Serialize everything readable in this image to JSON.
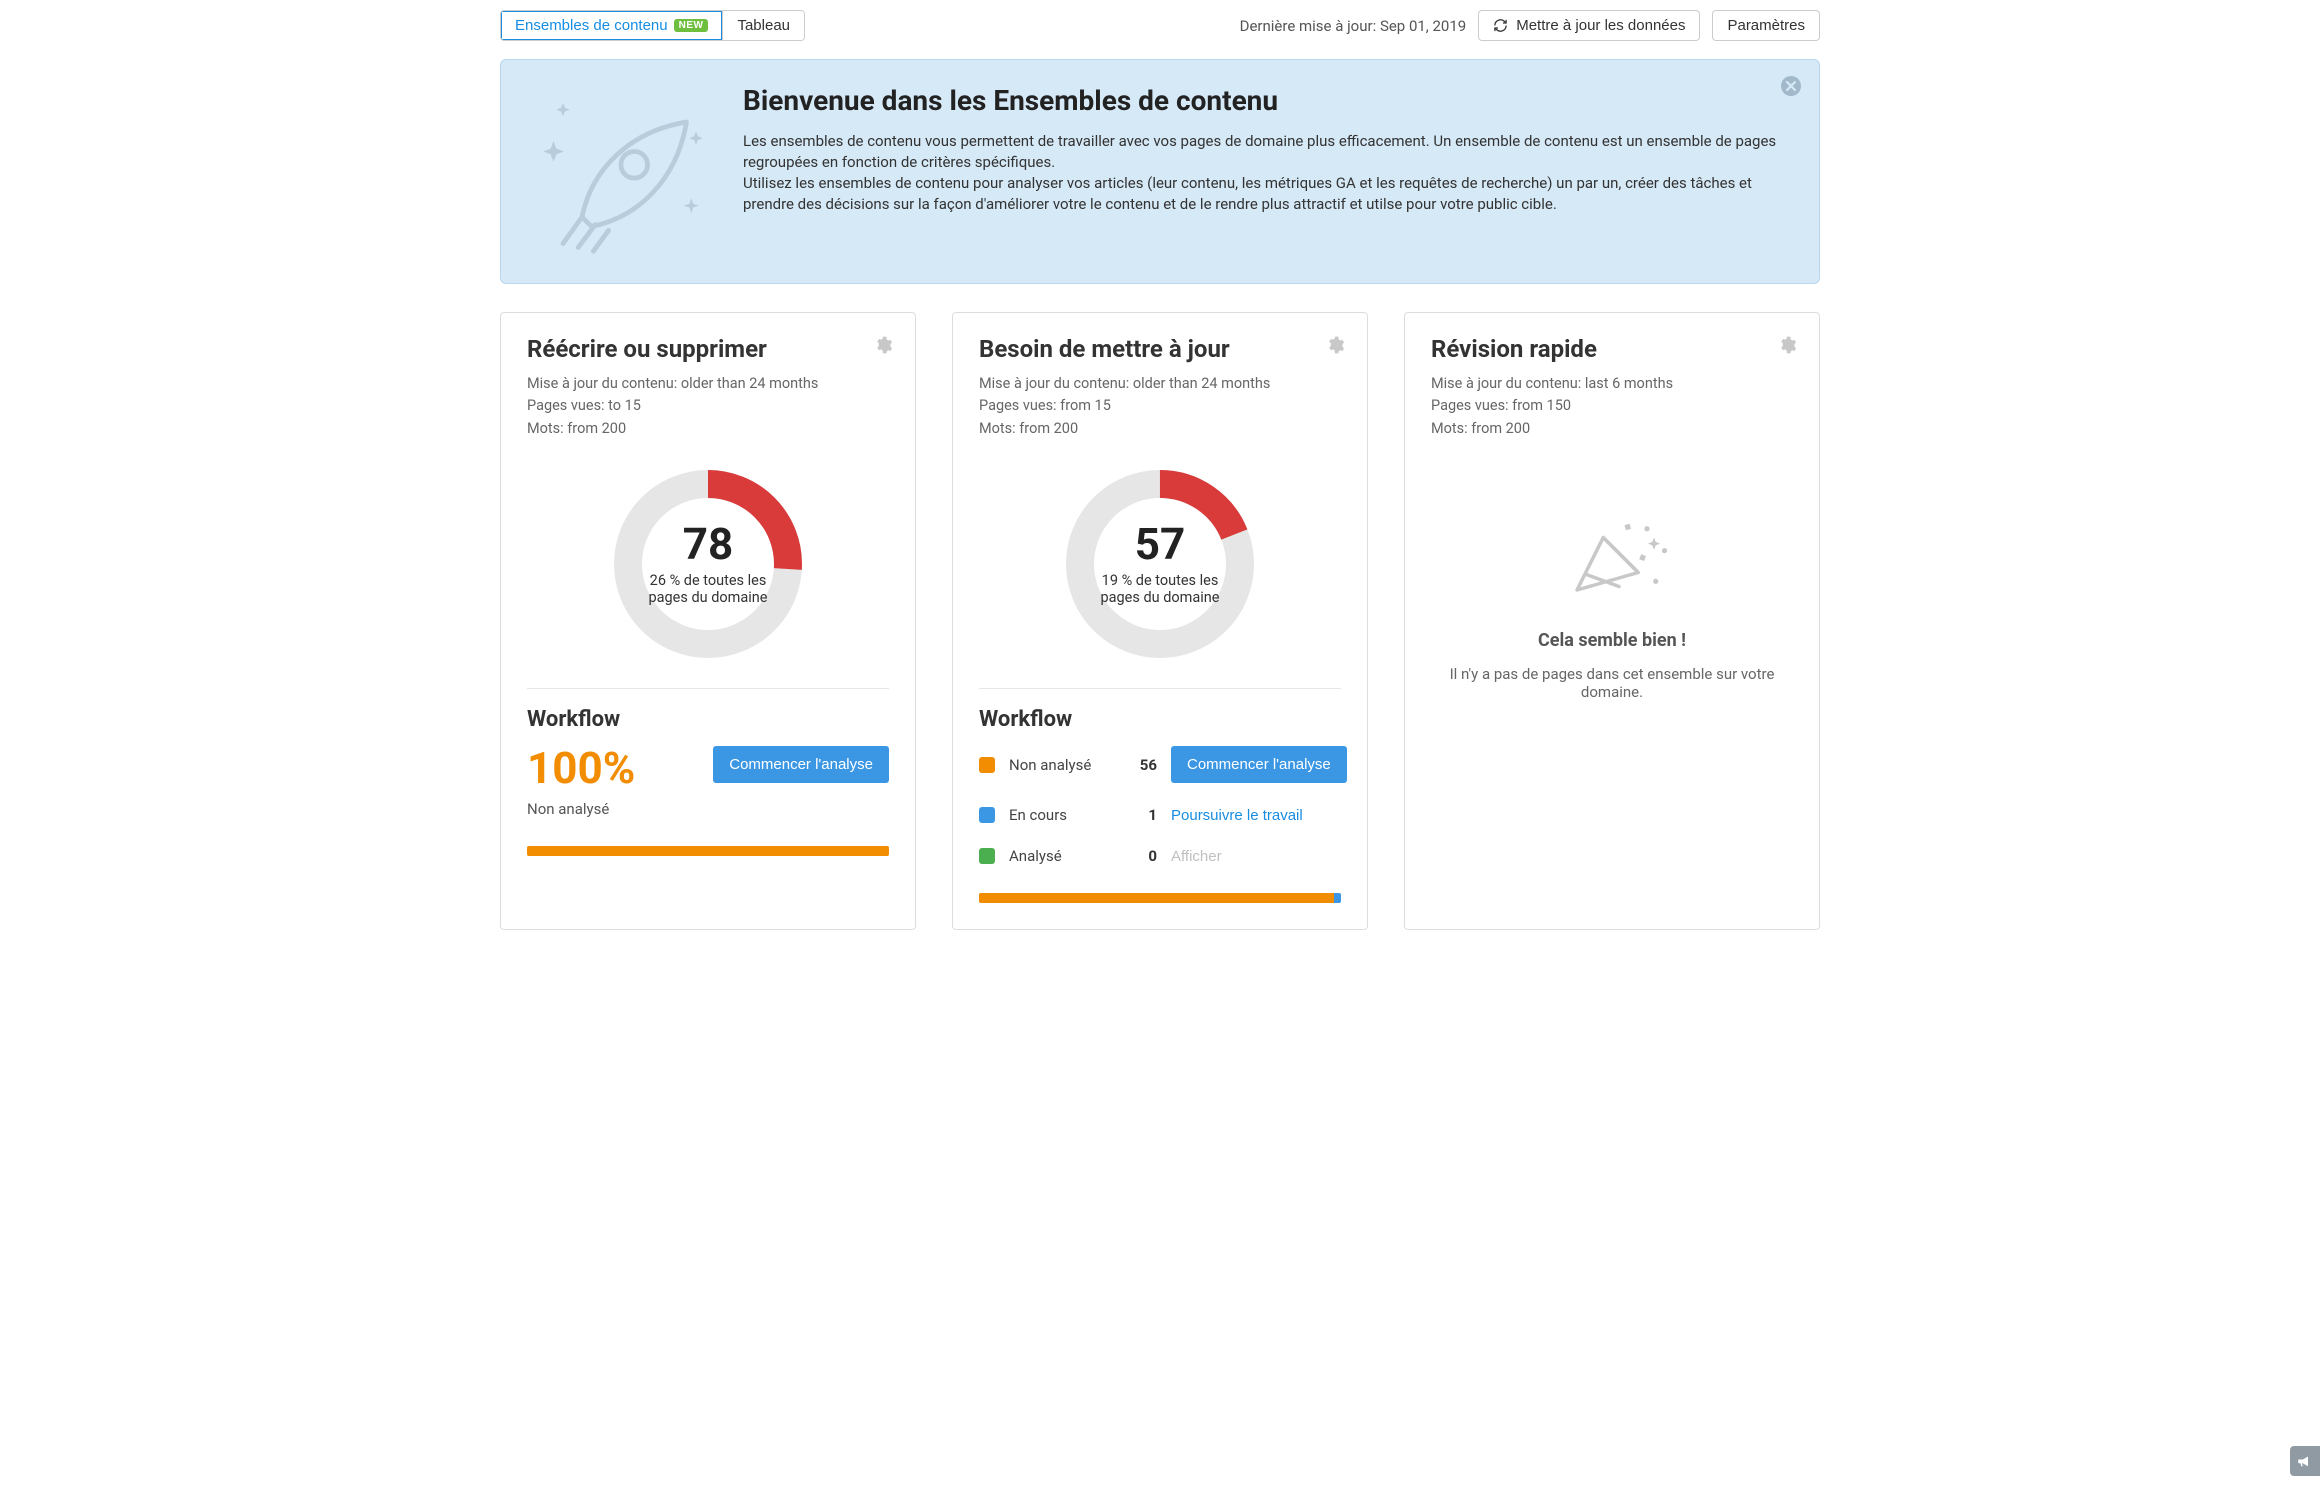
{
  "topbar": {
    "tab_content_sets": "Ensembles de contenu",
    "tab_content_sets_badge": "NEW",
    "tab_table": "Tableau",
    "last_update_label": "Dernière mise à jour: Sep 01, 2019",
    "refresh_btn": "Mettre à jour les données",
    "settings_btn": "Paramètres"
  },
  "banner": {
    "title": "Bienvenue dans les Ensembles de contenu",
    "p1": "Les ensembles de contenu vous permettent de travailler avec vos pages de domaine plus efficacement. Un ensemble de contenu est un ensemble de pages regroupées en fonction de critères spécifiques.",
    "p2": "Utilisez les ensembles de contenu pour analyser vos articles (leur contenu, les métriques GA et les requêtes de recherche) un par un, créer des tâches et prendre des décisions sur la façon d'améliorer votre le contenu et de le rendre plus attractif et utilse pour votre public cible."
  },
  "cards": {
    "c1": {
      "title": "Réécrire ou supprimer",
      "crit1": "Mise à jour du contenu: older than 24 months",
      "crit2": "Pages vues: to 15",
      "crit3": "Mots: from 200",
      "big": "78",
      "sub": "26 % de toutes les pages du domaine",
      "wf_title": "Workflow",
      "pct": "100%",
      "pct_label": "Non analysé",
      "cta": "Commencer l'analyse"
    },
    "c2": {
      "title": "Besoin de mettre à jour",
      "crit1": "Mise à jour du contenu: older than 24 months",
      "crit2": "Pages vues: from 15",
      "crit3": "Mots: from 200",
      "big": "57",
      "sub": "19 % de toutes les pages du domaine",
      "wf_title": "Workflow",
      "rows": [
        {
          "name": "Non analysé",
          "val": "56",
          "action": "Commencer l'analyse",
          "color": "orange",
          "kind": "primary"
        },
        {
          "name": "En cours",
          "val": "1",
          "action": "Poursuivre le travail",
          "color": "blue",
          "kind": "link"
        },
        {
          "name": "Analysé",
          "val": "0",
          "action": "Afficher",
          "color": "green",
          "kind": "muted"
        }
      ]
    },
    "c3": {
      "title": "Révision rapide",
      "crit1": "Mise à jour du contenu: last 6 months",
      "crit2": "Pages vues: from 150",
      "crit3": "Mots: from 200",
      "empty_title": "Cela semble bien !",
      "empty_text": "Il n'y a pas de pages dans cet ensemble sur votre domaine."
    }
  },
  "chart_data": [
    {
      "type": "pie",
      "title": "Réécrire ou supprimer",
      "series": [
        {
          "name": "part",
          "values": [
            26,
            74
          ]
        }
      ],
      "center_value": 78,
      "percent": 26,
      "colors": [
        "#d93a3a",
        "#e6e6e6"
      ]
    },
    {
      "type": "pie",
      "title": "Besoin de mettre à jour",
      "series": [
        {
          "name": "part",
          "values": [
            19,
            81
          ]
        }
      ],
      "center_value": 57,
      "percent": 19,
      "colors": [
        "#d93a3a",
        "#e6e6e6"
      ]
    },
    {
      "type": "bar",
      "title": "Workflow Réécrire ou supprimer",
      "categories": [
        "Non analysé"
      ],
      "values": [
        100
      ],
      "ylim": [
        0,
        100
      ],
      "colors": [
        "#f28c00"
      ]
    },
    {
      "type": "bar",
      "title": "Workflow Besoin de mettre à jour",
      "categories": [
        "Non analysé",
        "En cours",
        "Analysé"
      ],
      "values": [
        56,
        1,
        0
      ],
      "ylim": [
        0,
        57
      ],
      "colors": [
        "#f28c00",
        "#3b97e4",
        "#4bae4f"
      ]
    }
  ]
}
